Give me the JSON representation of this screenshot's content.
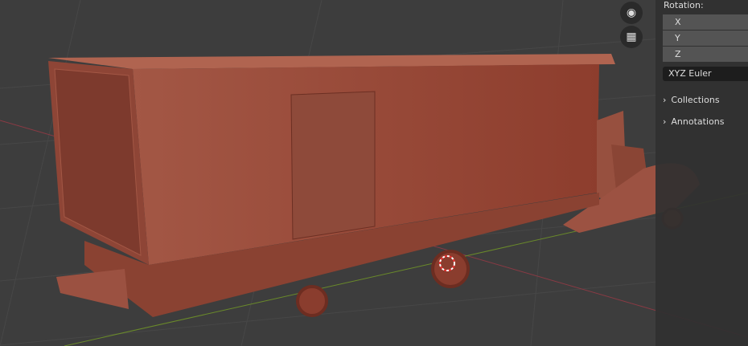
{
  "viewport": {
    "object": "truck-model",
    "object_color": "#a35745"
  },
  "nav": {
    "camera_icon": "camera-view-icon",
    "grid_icon": "perspective-grid-icon"
  },
  "panel": {
    "rotation_label": "Rotation:",
    "axes": [
      "X",
      "Y",
      "Z"
    ],
    "rotation_mode": "XYZ Euler",
    "sections": [
      "Collections",
      "Annotations"
    ]
  }
}
